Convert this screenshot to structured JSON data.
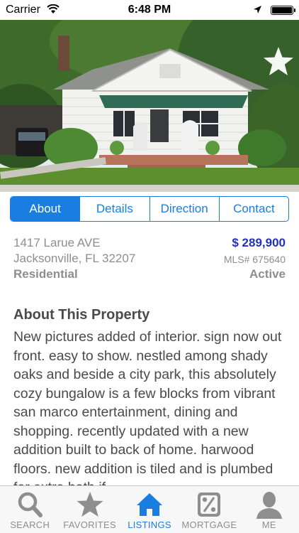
{
  "status_bar": {
    "carrier": "Carrier",
    "time": "6:48 PM"
  },
  "photo": {
    "favorite_icon": "star-icon"
  },
  "segments": [
    {
      "label": "About",
      "active": true
    },
    {
      "label": "Details",
      "active": false
    },
    {
      "label": "Direction",
      "active": false
    },
    {
      "label": "Contact",
      "active": false
    }
  ],
  "listing": {
    "street": "1417 Larue AVE",
    "city_line": "Jacksonville, FL 32207",
    "price": "$ 289,900",
    "mls": "MLS# 675640",
    "type": "Residential",
    "status": "Active"
  },
  "about": {
    "title": "About This Property",
    "text": "New pictures added of interior. sign now out front. easy to show. nestled among shady oaks and beside a city park, this absolutely cozy bungalow is a few blocks from vibrant san marco entertainment, dining and shopping. recently updated with a new addition built to back of home. harwood floors. new addition is tiled and is plumbed for extra bath if"
  },
  "tabbar": [
    {
      "label": "SEARCH",
      "icon": "search-icon",
      "active": false
    },
    {
      "label": "FAVORITES",
      "icon": "star-icon",
      "active": false
    },
    {
      "label": "LISTINGS",
      "icon": "home-icon",
      "active": true
    },
    {
      "label": "MORTGAGE",
      "icon": "percent-icon",
      "active": false
    },
    {
      "label": "ME",
      "icon": "person-icon",
      "active": false
    }
  ],
  "colors": {
    "accent": "#1a7ee0",
    "price": "#2330c0",
    "muted_text": "#8e8e8e"
  }
}
